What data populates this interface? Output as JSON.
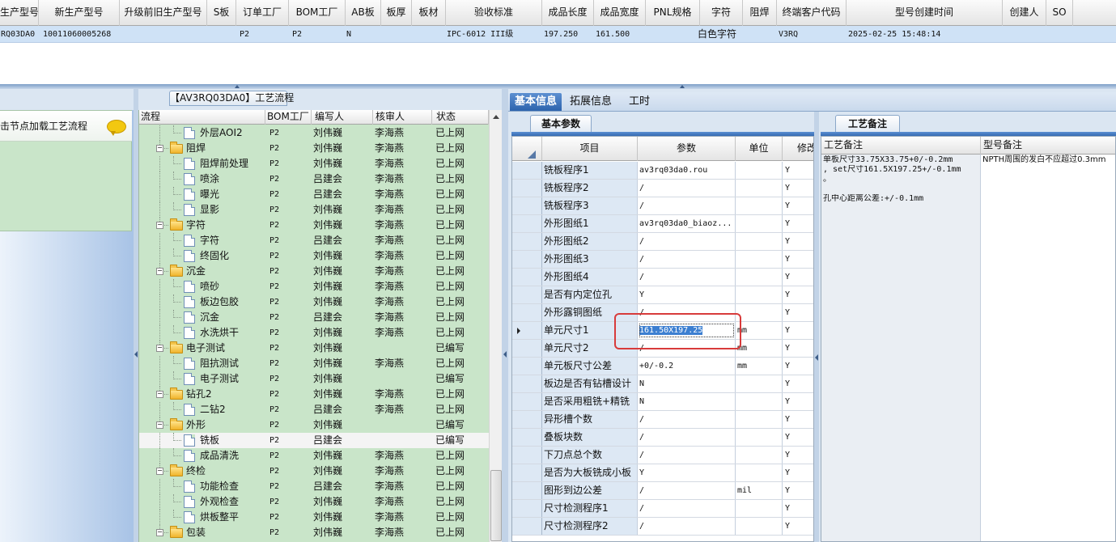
{
  "top_grid": {
    "headers": [
      "生产型号",
      "新生产型号",
      "升级前旧生产型号",
      "S板",
      "订单工厂",
      "BOM工厂",
      "AB板",
      "板厚",
      "板材",
      "验收标准",
      "成品长度",
      "成品宽度",
      "PNL规格",
      "字符",
      "阻焊",
      "终端客户代码",
      "型号创建时间",
      "创建人",
      "SO"
    ],
    "row": {
      "prod_model": "RQ03DA0",
      "new_prod_model": "10011060005268",
      "order_factory": "P2",
      "bom_factory": "P2",
      "ab_board": "N",
      "acceptance": "IPC-6012 III级",
      "length": "197.250",
      "width": "161.500",
      "character": "白色字符",
      "customer_code": "V3RQ",
      "created_time": "2025-02-25 15:48:14"
    }
  },
  "left_panel": {
    "hint": "击节点加载工艺流程"
  },
  "tree": {
    "title": "【AV3RQ03DA0】工艺流程",
    "headers": {
      "process": "流程",
      "bom_factory": "BOM工厂",
      "author": "编写人",
      "reviewer": "核审人",
      "status": "状态"
    },
    "rows": [
      {
        "name": "外层AOI2",
        "level": 1,
        "bom": "P2",
        "author": "刘伟巍",
        "reviewer": "李海燕",
        "status": "已上网"
      },
      {
        "name": "阻焊",
        "level": 0,
        "bom": "P2",
        "author": "刘伟巍",
        "reviewer": "李海燕",
        "status": "已上网"
      },
      {
        "name": "阻焊前处理",
        "level": 1,
        "bom": "P2",
        "author": "刘伟巍",
        "reviewer": "李海燕",
        "status": "已上网"
      },
      {
        "name": "喷涂",
        "level": 1,
        "bom": "P2",
        "author": "吕建会",
        "reviewer": "李海燕",
        "status": "已上网"
      },
      {
        "name": "曝光",
        "level": 1,
        "bom": "P2",
        "author": "吕建会",
        "reviewer": "李海燕",
        "status": "已上网"
      },
      {
        "name": "显影",
        "level": 1,
        "bom": "P2",
        "author": "刘伟巍",
        "reviewer": "李海燕",
        "status": "已上网"
      },
      {
        "name": "字符",
        "level": 0,
        "bom": "P2",
        "author": "刘伟巍",
        "reviewer": "李海燕",
        "status": "已上网"
      },
      {
        "name": "字符",
        "level": 1,
        "bom": "P2",
        "author": "吕建会",
        "reviewer": "李海燕",
        "status": "已上网"
      },
      {
        "name": "终固化",
        "level": 1,
        "bom": "P2",
        "author": "刘伟巍",
        "reviewer": "李海燕",
        "status": "已上网"
      },
      {
        "name": "沉金",
        "level": 0,
        "bom": "P2",
        "author": "刘伟巍",
        "reviewer": "李海燕",
        "status": "已上网"
      },
      {
        "name": "喷砂",
        "level": 1,
        "bom": "P2",
        "author": "刘伟巍",
        "reviewer": "李海燕",
        "status": "已上网"
      },
      {
        "name": "板边包胶",
        "level": 1,
        "bom": "P2",
        "author": "刘伟巍",
        "reviewer": "李海燕",
        "status": "已上网"
      },
      {
        "name": "沉金",
        "level": 1,
        "bom": "P2",
        "author": "吕建会",
        "reviewer": "李海燕",
        "status": "已上网"
      },
      {
        "name": "水洗烘干",
        "level": 1,
        "bom": "P2",
        "author": "刘伟巍",
        "reviewer": "李海燕",
        "status": "已上网"
      },
      {
        "name": "电子测试",
        "level": 0,
        "bom": "P2",
        "author": "刘伟巍",
        "reviewer": "",
        "status": "已编写"
      },
      {
        "name": "阻抗测试",
        "level": 1,
        "bom": "P2",
        "author": "刘伟巍",
        "reviewer": "李海燕",
        "status": "已上网"
      },
      {
        "name": "电子测试",
        "level": 1,
        "bom": "P2",
        "author": "刘伟巍",
        "reviewer": "",
        "status": "已编写"
      },
      {
        "name": "钻孔2",
        "level": 0,
        "bom": "P2",
        "author": "刘伟巍",
        "reviewer": "李海燕",
        "status": "已上网"
      },
      {
        "name": "二钻2",
        "level": 1,
        "bom": "P2",
        "author": "吕建会",
        "reviewer": "李海燕",
        "status": "已上网"
      },
      {
        "name": "外形",
        "level": 0,
        "bom": "P2",
        "author": "刘伟巍",
        "reviewer": "",
        "status": "已编写"
      },
      {
        "name": "铣板",
        "level": 1,
        "bom": "P2",
        "author": "吕建会",
        "reviewer": "",
        "status": "已编写",
        "selected": true
      },
      {
        "name": "成品清洗",
        "level": 1,
        "bom": "P2",
        "author": "刘伟巍",
        "reviewer": "李海燕",
        "status": "已上网"
      },
      {
        "name": "终检",
        "level": 0,
        "bom": "P2",
        "author": "刘伟巍",
        "reviewer": "李海燕",
        "status": "已上网"
      },
      {
        "name": "功能检查",
        "level": 1,
        "bom": "P2",
        "author": "吕建会",
        "reviewer": "李海燕",
        "status": "已上网"
      },
      {
        "name": "外观检查",
        "level": 1,
        "bom": "P2",
        "author": "刘伟巍",
        "reviewer": "李海燕",
        "status": "已上网"
      },
      {
        "name": "烘板整平",
        "level": 1,
        "bom": "P2",
        "author": "刘伟巍",
        "reviewer": "李海燕",
        "status": "已上网"
      },
      {
        "name": "包装",
        "level": 0,
        "bom": "P2",
        "author": "刘伟巍",
        "reviewer": "李海燕",
        "status": "已上网"
      }
    ]
  },
  "right_tabs": [
    "基本信息",
    "拓展信息",
    "工时"
  ],
  "params": {
    "subtab": "基本参数",
    "headers": {
      "item": "项目",
      "param": "参数",
      "unit": "单位",
      "modify": "修改"
    },
    "rows": [
      {
        "item": "铣板程序1",
        "val": "av3rq03da0.rou",
        "unit": "",
        "mod": "Y"
      },
      {
        "item": "铣板程序2",
        "val": "/",
        "unit": "",
        "mod": "Y"
      },
      {
        "item": "铣板程序3",
        "val": "/",
        "unit": "",
        "mod": "Y"
      },
      {
        "item": "外形图纸1",
        "val": "av3rq03da0_biaoz...",
        "unit": "",
        "mod": "Y"
      },
      {
        "item": "外形图纸2",
        "val": "/",
        "unit": "",
        "mod": "Y"
      },
      {
        "item": "外形图纸3",
        "val": "/",
        "unit": "",
        "mod": "Y"
      },
      {
        "item": "外形图纸4",
        "val": "/",
        "unit": "",
        "mod": "Y"
      },
      {
        "item": "是否有内定位孔",
        "val": "Y",
        "unit": "",
        "mod": "Y"
      },
      {
        "item": "外形露铜图纸",
        "val": "/",
        "unit": "",
        "mod": "Y"
      },
      {
        "item": "单元尺寸1",
        "val": "161.50X197.25",
        "unit": "mm",
        "mod": "Y",
        "current": true
      },
      {
        "item": "单元尺寸2",
        "val": "/",
        "unit": "mm",
        "mod": "Y"
      },
      {
        "item": "单元板尺寸公差",
        "val": "+0/-0.2",
        "unit": "mm",
        "mod": "Y"
      },
      {
        "item": "板边是否有钻槽设计",
        "val": "N",
        "unit": "",
        "mod": "Y"
      },
      {
        "item": "是否采用粗铣+精铣",
        "val": "N",
        "unit": "",
        "mod": "Y"
      },
      {
        "item": "异形槽个数",
        "val": "/",
        "unit": "",
        "mod": "Y"
      },
      {
        "item": "叠板块数",
        "val": "/",
        "unit": "",
        "mod": "Y"
      },
      {
        "item": "下刀点总个数",
        "val": "/",
        "unit": "",
        "mod": "Y"
      },
      {
        "item": "是否为大板铣成小板",
        "val": "Y",
        "unit": "",
        "mod": "Y"
      },
      {
        "item": "图形到边公差",
        "val": "/",
        "unit": "mil",
        "mod": "Y"
      },
      {
        "item": "尺寸检测程序1",
        "val": "/",
        "unit": "",
        "mod": "Y"
      },
      {
        "item": "尺寸检测程序2",
        "val": "/",
        "unit": "",
        "mod": "Y"
      }
    ]
  },
  "notes": {
    "subtab": "工艺备注",
    "headers": {
      "process_note": "工艺备注",
      "model_note": "型号备注"
    },
    "process_note_lines": [
      "单板尺寸33.75X33.75+0/-0.2mm",
      ", set尺寸161.5X197.25+/-0.1mm",
      "。",
      "",
      "孔中心距离公差:+/-0.1mm"
    ],
    "model_note": "NPTH周围的发白不应超过0.3mm"
  }
}
